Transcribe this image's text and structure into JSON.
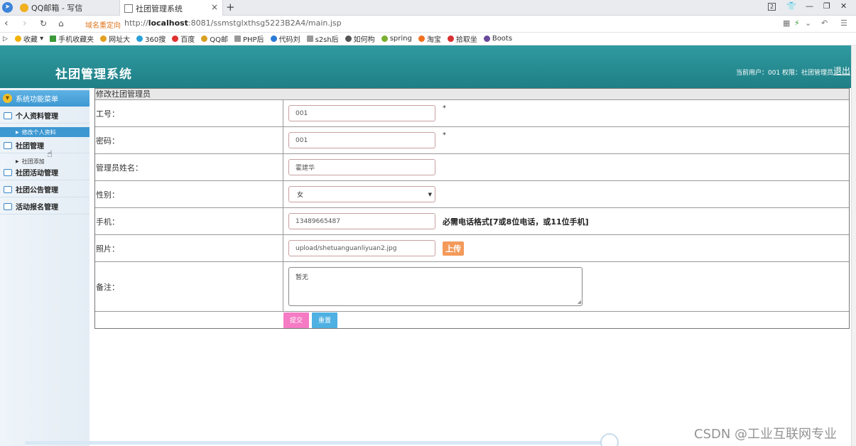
{
  "browser": {
    "tabs": [
      {
        "label": "QQ邮箱 - 写信"
      },
      {
        "label": "社团管理系统"
      }
    ],
    "new_tab": "+",
    "tab_close": "×",
    "window_badge": "2",
    "redirect_label": "域名重定向",
    "url_prefix": "http://",
    "url_host": "localhost",
    "url_rest": ":8081/ssmstglxthsg5223B2A4/main.jsp",
    "bookmarks": [
      {
        "label": "收藏",
        "color": "#f2b000"
      },
      {
        "label": "手机收藏夹",
        "color": "#3a9a3a"
      },
      {
        "label": "网址大",
        "color": "#e2a020"
      },
      {
        "label": "360搜",
        "color": "#2aa0d8"
      },
      {
        "label": "百度",
        "color": "#e03030"
      },
      {
        "label": "QQ邮",
        "color": "#d8a020"
      },
      {
        "label": "PHP后",
        "color": "#999999"
      },
      {
        "label": "代码刘",
        "color": "#2a7ad8"
      },
      {
        "label": "s2sh后",
        "color": "#999999"
      },
      {
        "label": "如何构",
        "color": "#555555"
      },
      {
        "label": "spring",
        "color": "#7ab030"
      },
      {
        "label": "淘宝",
        "color": "#f07020"
      },
      {
        "label": "拾取坐",
        "color": "#d83030"
      },
      {
        "label": "Boots",
        "color": "#6a4a9a"
      }
    ]
  },
  "header": {
    "title": "社团管理系统",
    "user_info": "当前用户：001  权限：社团管理员",
    "logout": "退出"
  },
  "sidebar": {
    "head": "系统功能菜单",
    "groups": [
      {
        "label": "个人资料管理",
        "subs": [
          "修改个人资料"
        ]
      },
      {
        "label": "社团管理",
        "subs": [
          "社团添加"
        ]
      },
      {
        "label": "社团活动管理",
        "subs": []
      },
      {
        "label": "社团公告管理",
        "subs": []
      },
      {
        "label": "活动报名管理",
        "subs": []
      }
    ]
  },
  "form": {
    "caption": "修改社团管理员",
    "fields": {
      "id": {
        "label": "工号：",
        "value": "001",
        "required": "*"
      },
      "password": {
        "label": "密码：",
        "value": "001",
        "required": "*"
      },
      "name": {
        "label": "管理员姓名：",
        "value": "霍建华"
      },
      "gender": {
        "label": "性别：",
        "value": "女"
      },
      "phone": {
        "label": "手机：",
        "value": "13489665487",
        "hint": "必需电话格式[7或8位电话，或11位手机]"
      },
      "photo": {
        "label": "照片：",
        "value": "upload/shetuanguanliyuan2.jpg",
        "upload": "上传"
      },
      "remark": {
        "label": "备注：",
        "value": "暂无"
      }
    },
    "submit": "提交",
    "reset": "重置"
  },
  "watermark": "CSDN @工业互联网专业"
}
